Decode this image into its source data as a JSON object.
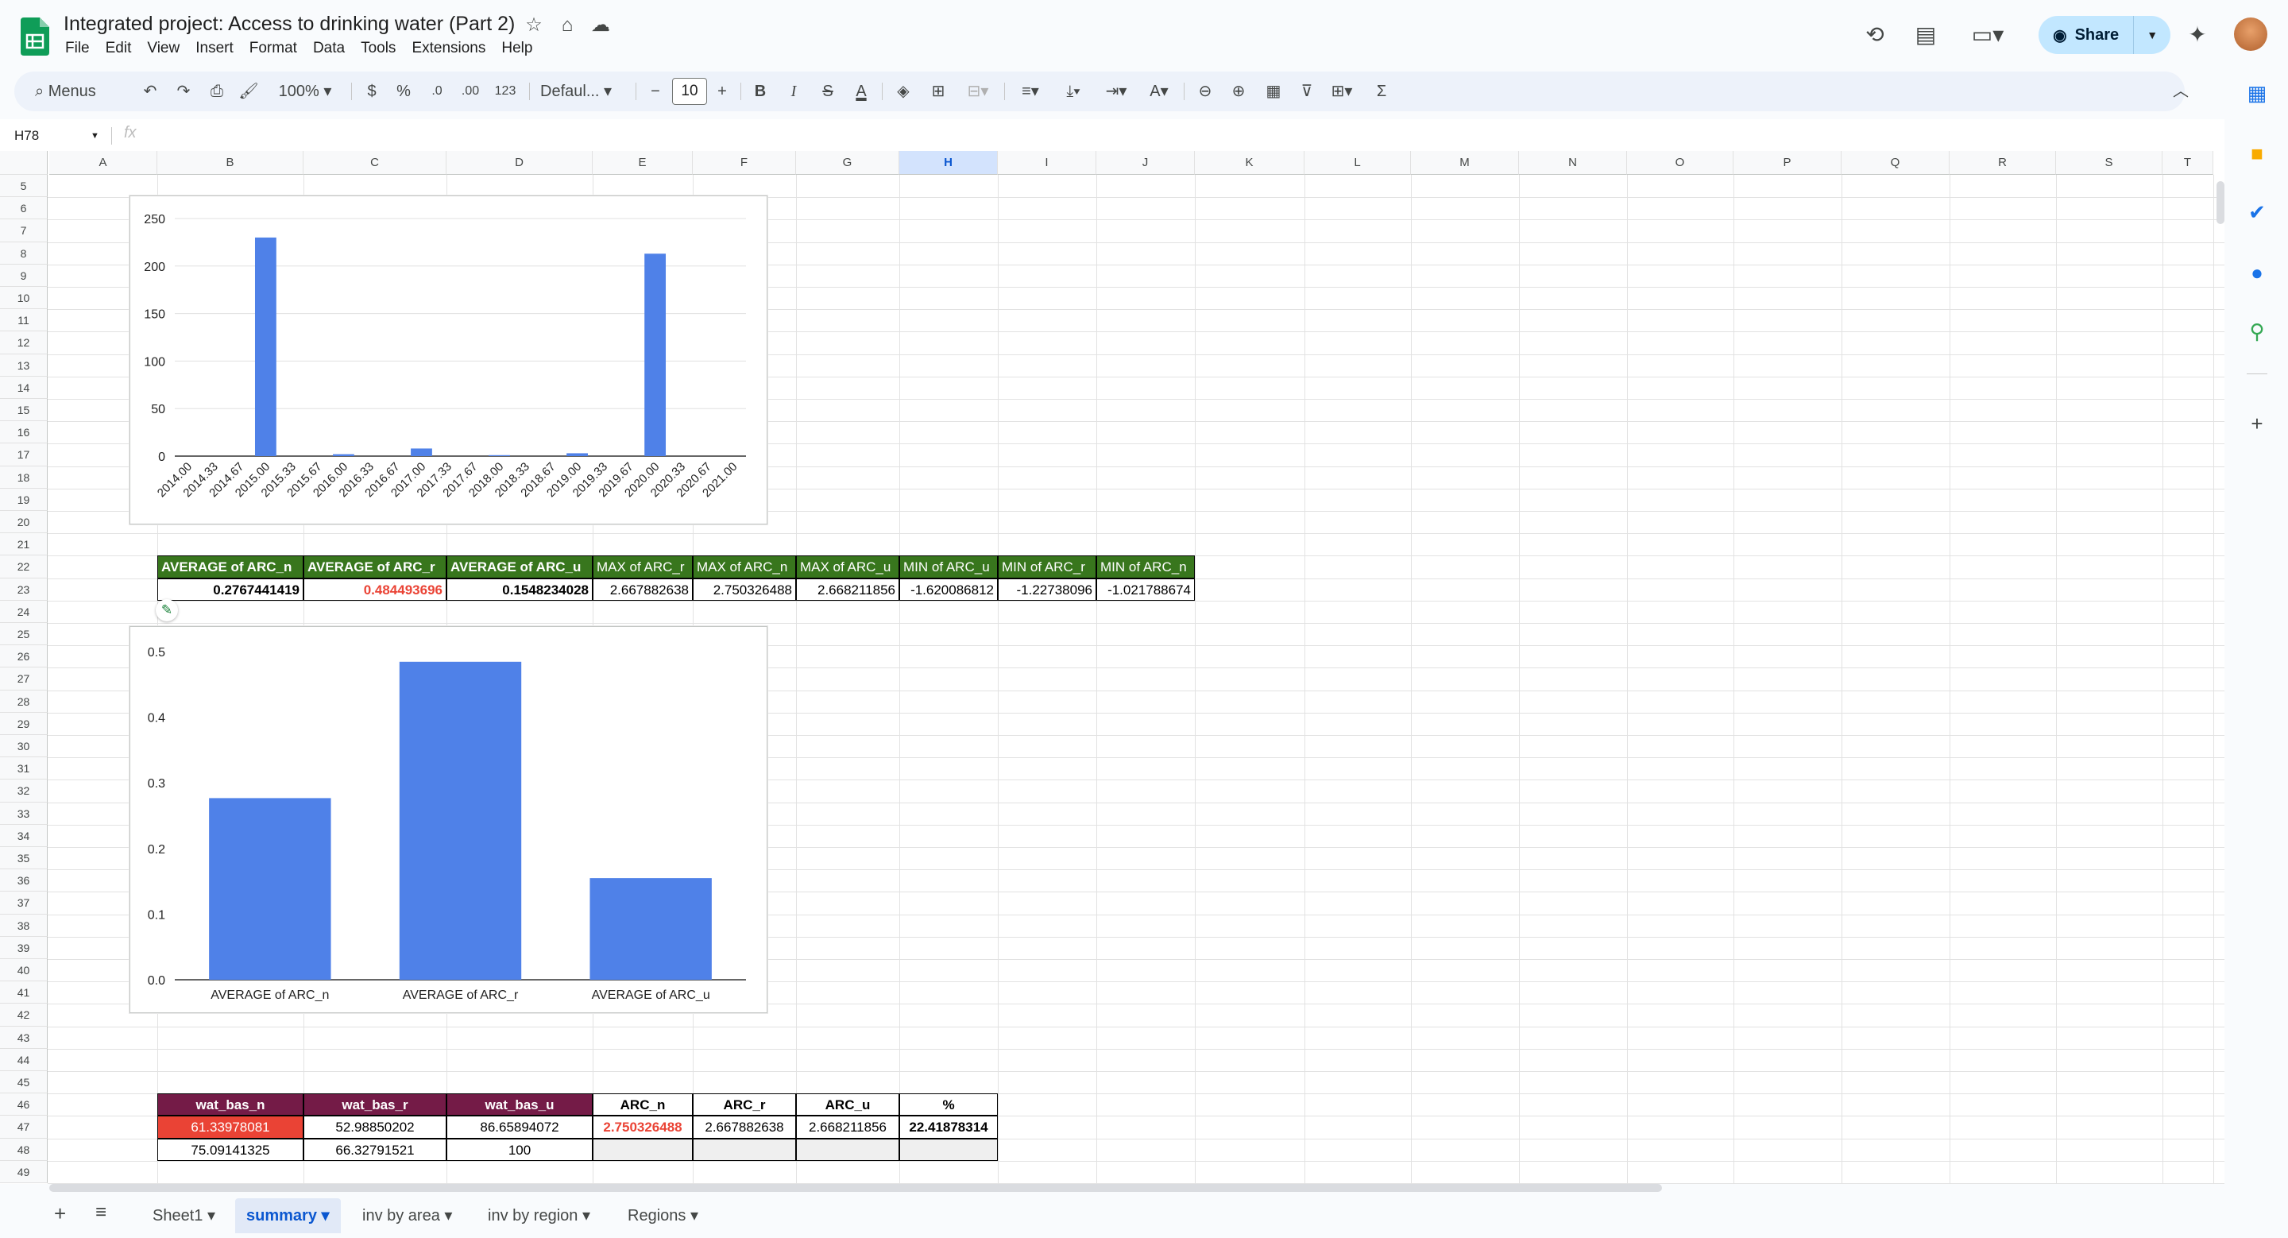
{
  "doc": {
    "title": "Integrated project: Access to drinking water (Part 2)"
  },
  "menu": [
    "File",
    "Edit",
    "View",
    "Insert",
    "Format",
    "Data",
    "Tools",
    "Extensions",
    "Help"
  ],
  "share": {
    "label": "Share"
  },
  "toolbar": {
    "search_label": "Menus",
    "zoom": "100%",
    "currency": "$",
    "percent": "%",
    "decimal_dec": ".0",
    "decimal_inc": ".00",
    "number_format": "123",
    "font": "Defaul...",
    "font_size": "10",
    "bold": "B",
    "italic": "I",
    "sigma": "Σ"
  },
  "formula": {
    "name_box": "H78",
    "fx": "fx"
  },
  "columns": [
    "A",
    "B",
    "C",
    "D",
    "E",
    "F",
    "G",
    "H",
    "I",
    "J",
    "K",
    "L",
    "M",
    "N",
    "O",
    "P",
    "Q",
    "R",
    "S",
    "T"
  ],
  "selected_column": "H",
  "rows": [
    "5",
    "6",
    "7",
    "8",
    "9",
    "10",
    "11",
    "12",
    "13",
    "14",
    "15",
    "16",
    "17",
    "18",
    "19",
    "20",
    "21",
    "22",
    "23",
    "24",
    "25",
    "26",
    "27",
    "28",
    "29",
    "30",
    "31",
    "32",
    "33",
    "34",
    "35",
    "36",
    "37",
    "38",
    "39",
    "40",
    "41",
    "42",
    "43",
    "44",
    "45",
    "46",
    "47",
    "48",
    "49"
  ],
  "stats_table": {
    "headers": [
      "AVERAGE of ARC_n",
      "AVERAGE of ARC_r",
      "AVERAGE of ARC_u",
      "MAX of ARC_r",
      "MAX of ARC_n",
      "MAX of ARC_u",
      "MIN of ARC_u",
      "MIN of ARC_r",
      "MIN of ARC_n"
    ],
    "values": [
      "0.2767441419",
      "0.484493696",
      "0.1548234028",
      "2.667882638",
      "2.750326488",
      "2.668211856",
      "-1.620086812",
      "-1.22738096",
      "-1.021788674"
    ],
    "highlight_color": "#ea4335"
  },
  "water_table": {
    "headers": [
      "wat_bas_n",
      "wat_bas_r",
      "wat_bas_u",
      "ARC_n",
      "ARC_r",
      "ARC_u",
      "%"
    ],
    "row1": [
      "61.33978081",
      "52.98850202",
      "86.65894072",
      "2.750326488",
      "2.667882638",
      "2.668211856",
      "22.41878314"
    ],
    "row2": [
      "75.09141325",
      "66.32791521",
      "100",
      "",
      "",
      "",
      ""
    ]
  },
  "chart_data": [
    {
      "type": "bar",
      "title": "",
      "xlabel": "",
      "ylabel": "",
      "categories": [
        "2014.00",
        "2014.33",
        "2014.67",
        "2015.00",
        "2015.33",
        "2015.67",
        "2016.00",
        "2016.33",
        "2016.67",
        "2017.00",
        "2017.33",
        "2017.67",
        "2018.00",
        "2018.33",
        "2018.67",
        "2019.00",
        "2019.33",
        "2019.67",
        "2020.00",
        "2020.33",
        "2020.67",
        "2021.00"
      ],
      "values": [
        0,
        0,
        0,
        230,
        0,
        0,
        2,
        0,
        0,
        8,
        0,
        0,
        1,
        0,
        0,
        3,
        0,
        0,
        213,
        0,
        0,
        0
      ],
      "yticks": [
        "0",
        "50",
        "100",
        "150",
        "200",
        "250"
      ],
      "ylim": [
        0,
        250
      ],
      "grid": true,
      "color": "#4f81e8"
    },
    {
      "type": "bar",
      "title": "",
      "xlabel": "",
      "ylabel": "",
      "categories": [
        "AVERAGE of ARC_n",
        "AVERAGE of ARC_r",
        "AVERAGE of ARC_u"
      ],
      "values": [
        0.2767441419,
        0.484493696,
        0.1548234028
      ],
      "yticks": [
        "0.0",
        "0.1",
        "0.2",
        "0.3",
        "0.4",
        "0.5"
      ],
      "ylim": [
        0,
        0.5
      ],
      "grid": false,
      "color": "#4f81e8"
    }
  ],
  "sheets": [
    "Sheet1",
    "summary",
    "inv by area",
    "inv by region",
    "Regions"
  ],
  "active_sheet": "summary"
}
